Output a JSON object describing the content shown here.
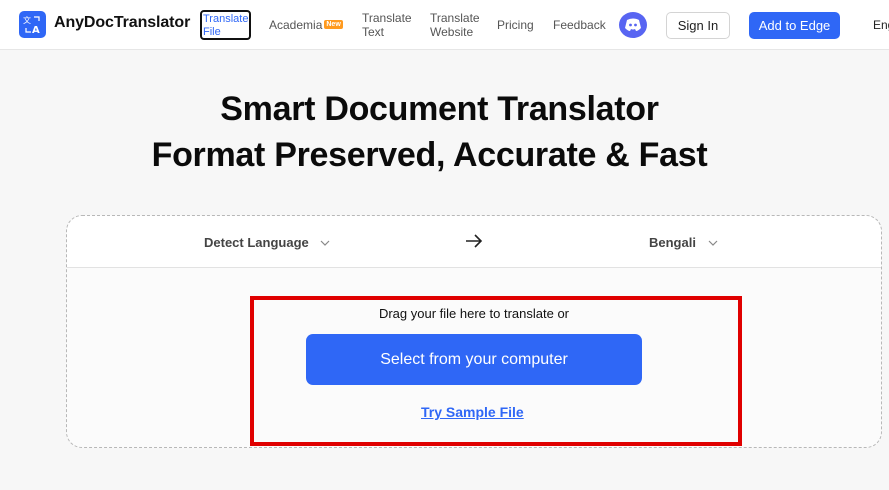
{
  "header": {
    "brand": "AnyDocTranslator",
    "logo_icon": "translate-icon",
    "nav": {
      "translate_file": "Translate File",
      "academia": "Academia",
      "academia_badge": "New",
      "translate_text_line1": "Translate",
      "translate_text_line2": "Text",
      "translate_website_line1": "Translate",
      "translate_website_line2": "Website",
      "pricing": "Pricing",
      "feedback": "Feedback"
    },
    "discord_icon": "discord-icon",
    "sign_in": "Sign In",
    "add_to_edge": "Add to Edge",
    "language_menu": "Eng"
  },
  "hero": {
    "title_line1": "Smart Document Translator",
    "title_line2": "Format Preserved, Accurate & Fast"
  },
  "translator": {
    "source_language": "Detect Language",
    "target_language": "Bengali",
    "swap_icon": "arrow-right-icon",
    "drag_text": "Drag your file here to translate or",
    "select_button": "Select from your computer",
    "sample_link": "Try Sample File"
  },
  "colors": {
    "brand_blue": "#2f67f6",
    "badge_orange": "#ff9a1f",
    "highlight_red": "#e00000",
    "discord": "#5865f2"
  }
}
